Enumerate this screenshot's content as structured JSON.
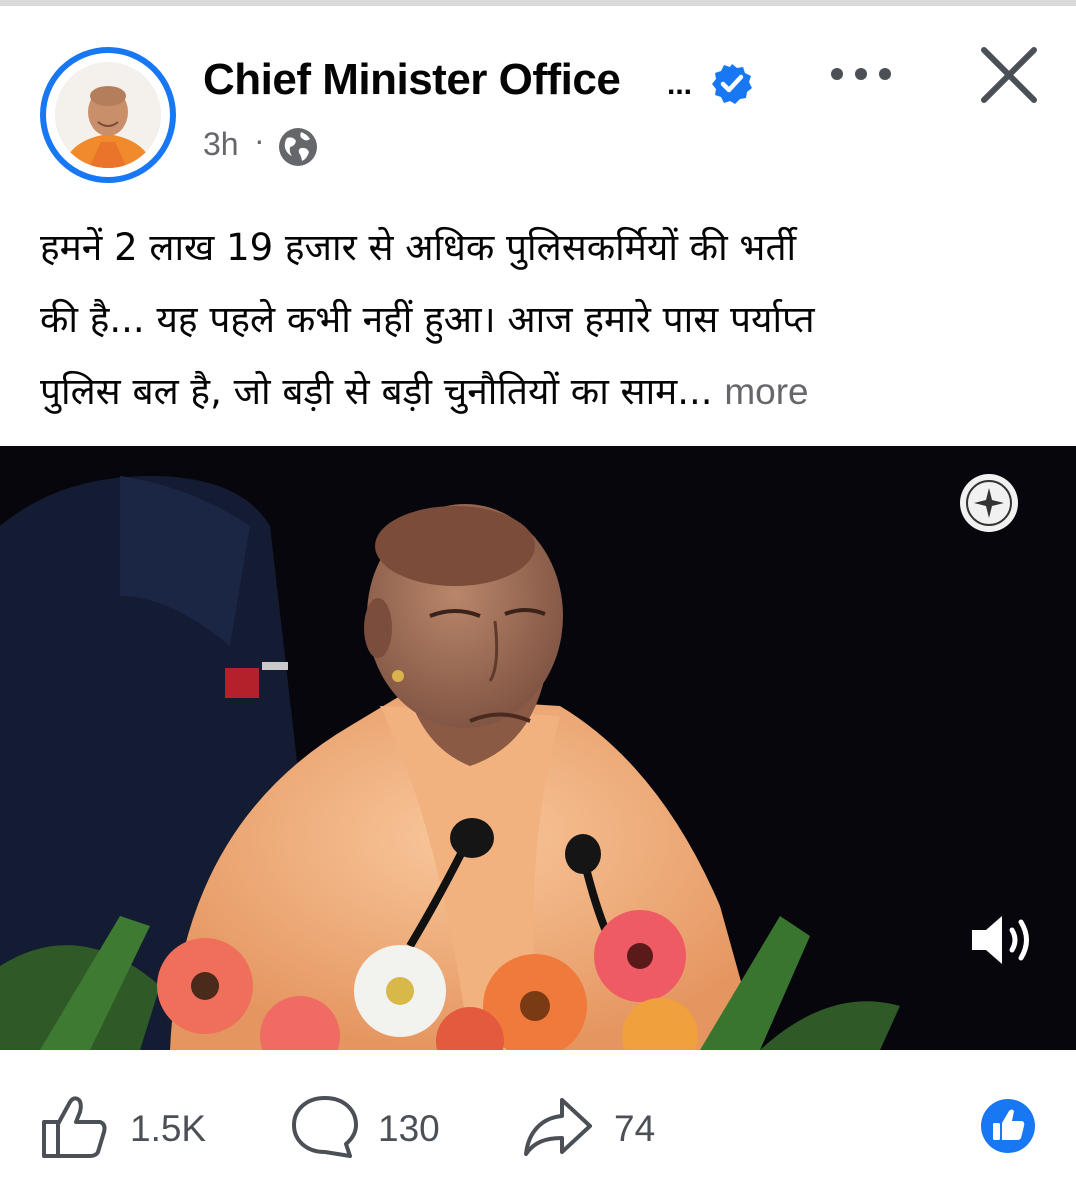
{
  "post": {
    "page_name": "Chief Minister Office",
    "name_ellipsis": "...",
    "time": "3h",
    "separator": "·",
    "audience_icon": "globe-icon",
    "text_lines": [
      "हमनें 2 लाख 19 हजार से अधिक पुलिसकर्मियों की भर्ती",
      "की है... यह पहले कभी नहीं हुआ। आज हमारे पास पर्याप्त",
      "पुलिस बल है, जो बड़ी से बड़ी चुनौतियों का साम..."
    ],
    "see_more": "more"
  },
  "actions": {
    "likes": "1.5K",
    "comments": "130",
    "shares": "74"
  },
  "colors": {
    "accent": "#1877f2",
    "muted_text": "#65676b",
    "video_bg": "#07060d"
  },
  "icons": [
    "verified-badge-icon",
    "more-options-icon",
    "close-icon",
    "globe-icon",
    "sound-on-icon",
    "like-icon",
    "comment-icon",
    "share-icon",
    "like-reaction-icon"
  ]
}
